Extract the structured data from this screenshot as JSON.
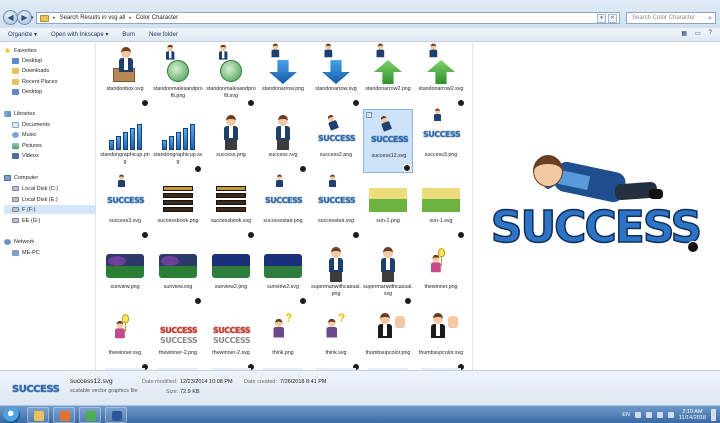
{
  "address_bar": {
    "crumbs": [
      "Search Results in vsg all",
      "Color Character"
    ],
    "search_placeholder": "Search Color Character"
  },
  "toolbar": {
    "organize": "Organize ▾",
    "open_with": "Open with Inkscape ▾",
    "burn": "Burn",
    "new_folder": "New folder"
  },
  "nav": {
    "favorites_header": "Favorites",
    "favorites": [
      "Desktop",
      "Downloads",
      "Recent Places",
      "Desktop"
    ],
    "libraries_header": "Libraries",
    "libraries": [
      "Documents",
      "Music",
      "Pictures",
      "Videos"
    ],
    "computer_header": "Computer",
    "drives": [
      "Local Disk (C:)",
      "Local Disk (E:)",
      "F (F:)",
      "EE (G:)"
    ],
    "network_header": "Network",
    "network": [
      "ME-PC"
    ]
  },
  "files": [
    {
      "name": "standonbox.svg",
      "kind": "person-box"
    },
    {
      "name": "standonmalesandprofit.png",
      "kind": "globe"
    },
    {
      "name": "standonmalesandprofit.svg",
      "kind": "globe"
    },
    {
      "name": "standonarrow.png",
      "kind": "arrow-blue"
    },
    {
      "name": "standonarrow.svg",
      "kind": "arrow-blue"
    },
    {
      "name": "standonarrow2.png",
      "kind": "arrow-green"
    },
    {
      "name": "standonarrow2.svg",
      "kind": "arrow-green"
    },
    {
      "name": "standongraphicup.png",
      "kind": "bars"
    },
    {
      "name": "standongraphicup.svg",
      "kind": "bars"
    },
    {
      "name": "success.png",
      "kind": "person"
    },
    {
      "name": "success.svg",
      "kind": "person"
    },
    {
      "name": "success2.png",
      "kind": "success-lying"
    },
    {
      "name": "success12.svg",
      "kind": "success-lying",
      "selected": true
    },
    {
      "name": "success3.png",
      "kind": "success-word"
    },
    {
      "name": "success3.svg",
      "kind": "success-word"
    },
    {
      "name": "successbook.png",
      "kind": "books"
    },
    {
      "name": "successbook.svg",
      "kind": "books"
    },
    {
      "name": "successstair.png",
      "kind": "success-word"
    },
    {
      "name": "successtair.svg",
      "kind": "success-word"
    },
    {
      "name": "sun-1.png",
      "kind": "field"
    },
    {
      "name": "sun-1.svg",
      "kind": "field"
    },
    {
      "name": "sunview.png",
      "kind": "sunview"
    },
    {
      "name": "sunview.svg",
      "kind": "sunview"
    },
    {
      "name": "sunview2.png",
      "kind": "sunview-blue"
    },
    {
      "name": "sunview2.svg",
      "kind": "sunview-blue"
    },
    {
      "name": "supermanwithcasual.png",
      "kind": "person"
    },
    {
      "name": "supermanwithcasual.svg",
      "kind": "person"
    },
    {
      "name": "thewinner.png",
      "kind": "bulb"
    },
    {
      "name": "thewinner.svg",
      "kind": "bulb"
    },
    {
      "name": "thewinner-2.png",
      "kind": "success-red"
    },
    {
      "name": "thewinner-2.svg",
      "kind": "success-red"
    },
    {
      "name": "think.png",
      "kind": "question"
    },
    {
      "name": "think.svg",
      "kind": "question"
    },
    {
      "name": "thumbsupcolor.png",
      "kind": "thumbs"
    },
    {
      "name": "thumbsupcolor.svg",
      "kind": "thumbs"
    }
  ],
  "details": {
    "name": "success12.svg",
    "type": "scalable vector graphics file",
    "modified_label": "Date modified:",
    "modified_value": "12/23/2014 10:08 PM",
    "created_label": "Date created:",
    "created_value": "7/26/2018 8:41 PM",
    "size_label": "Size:",
    "size_value": "72.9 KB"
  },
  "preview": {
    "word": "SUCCESS"
  },
  "taskbar": {
    "lang": "EN",
    "time": "2:10 AM",
    "date": "11/14/2018",
    "apps": [
      {
        "name": "explorer",
        "color": "#e8c25a"
      },
      {
        "name": "xampp",
        "color": "#e8702a"
      },
      {
        "name": "chrome",
        "color": "#4caf50"
      },
      {
        "name": "word",
        "color": "#2b5797"
      }
    ]
  },
  "colors": {
    "accent": "#2f74c4",
    "selection": "#cde3f9"
  }
}
